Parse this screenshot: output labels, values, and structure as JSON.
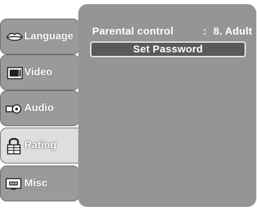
{
  "sidebar": {
    "items": [
      {
        "label": "Language",
        "icon": "lips-icon"
      },
      {
        "label": "Video",
        "icon": "monitor-icon"
      },
      {
        "label": "Audio",
        "icon": "speaker-icon"
      },
      {
        "label": "Rating",
        "icon": "padlock-icon",
        "active": true
      },
      {
        "label": "Misc",
        "icon": "screen-menu-icon"
      }
    ]
  },
  "main": {
    "setting": {
      "label": "Parental control",
      "separator": ":",
      "value": "8. Adult"
    },
    "set_password_label": "Set Password"
  },
  "colors": {
    "panel": "#959595",
    "tab": "#9a9a9a",
    "tab_active": "#dedede",
    "button": "#5a5a5a",
    "text": "#ffffff"
  }
}
